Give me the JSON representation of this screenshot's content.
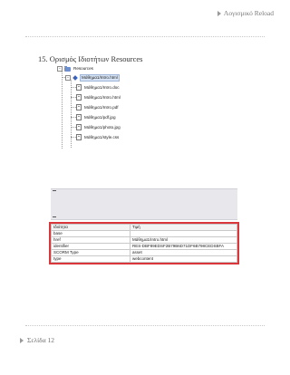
{
  "header": {
    "title": "Λογισμικό Reload"
  },
  "section": {
    "title": "15. Ορισμός Ιδιοτήτων Resources"
  },
  "tree": {
    "root_label": "Resources",
    "selected_item": "Μάθημα1/Intro.html",
    "files": [
      "Μάθημα1/Intro.doc",
      "Μάθημα1/Intro.html",
      "Μάθημα1/Intro.pdf",
      "Μάθημα1/pdf.jpg",
      "Μάθημα1/photo.jpg",
      "Μάθημα1/style.css"
    ]
  },
  "properties": {
    "headers": [
      "Ιδιότητα",
      "Τιμή"
    ],
    "rows": [
      [
        "base",
        ""
      ],
      [
        "href",
        "Μάθημα1/Intro.html"
      ],
      [
        "identifier",
        "RES-DBF89EDSF2B79B6D71DF6B798CEDSBFA"
      ],
      [
        "SCORM Type",
        "asset"
      ],
      [
        "type",
        "webcontent"
      ]
    ]
  },
  "footer": {
    "page_label": "Σελίδα 12"
  }
}
